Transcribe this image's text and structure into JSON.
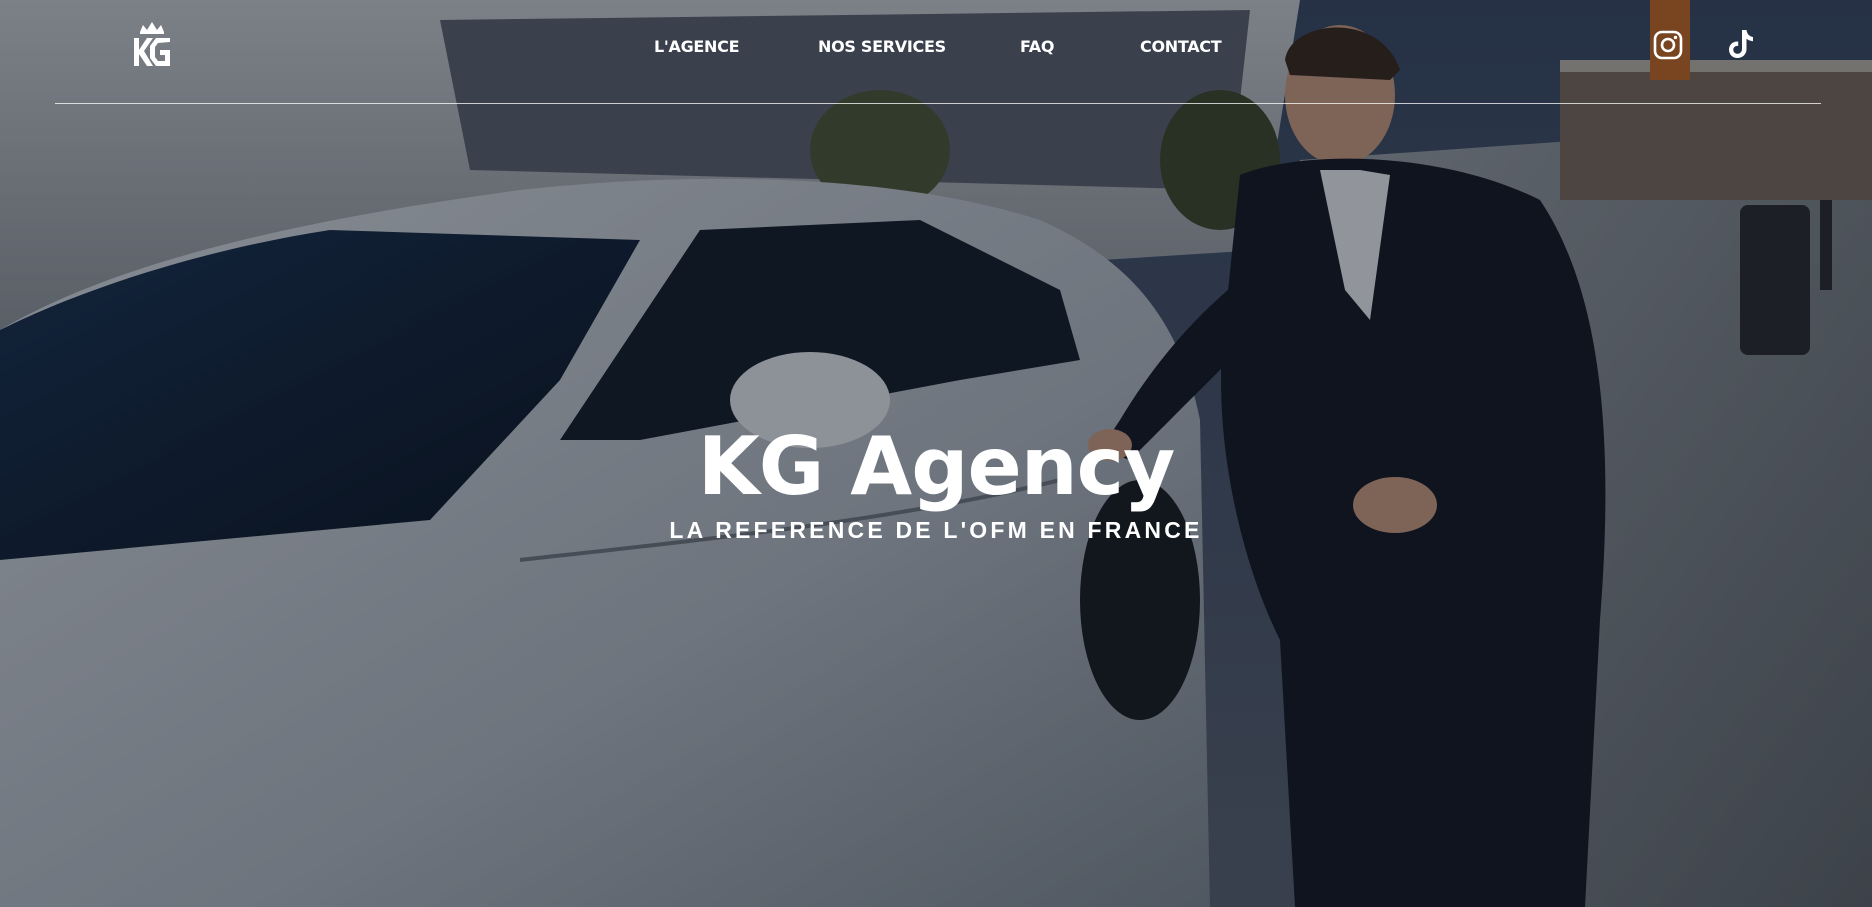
{
  "brand": {
    "logo_icon": "kg-crown-logo-icon"
  },
  "nav": {
    "items": [
      {
        "label": "L'AGENCE"
      },
      {
        "label": "NOS SERVICES"
      },
      {
        "label": "FAQ"
      },
      {
        "label": "CONTACT"
      }
    ]
  },
  "social": {
    "instagram_icon": "instagram-icon",
    "tiktok_icon": "tiktok-icon"
  },
  "hero": {
    "title": "KG Agency",
    "subtitle": "LA REFERENCE DE L'OFM EN FRANCE",
    "background": "photo of a man in a dark suit opening the door of a white luxury car at a marina"
  },
  "colors": {
    "text": "#ffffff",
    "overlay": "#060a12",
    "car": "#c9cfd6",
    "suit": "#151a26"
  }
}
